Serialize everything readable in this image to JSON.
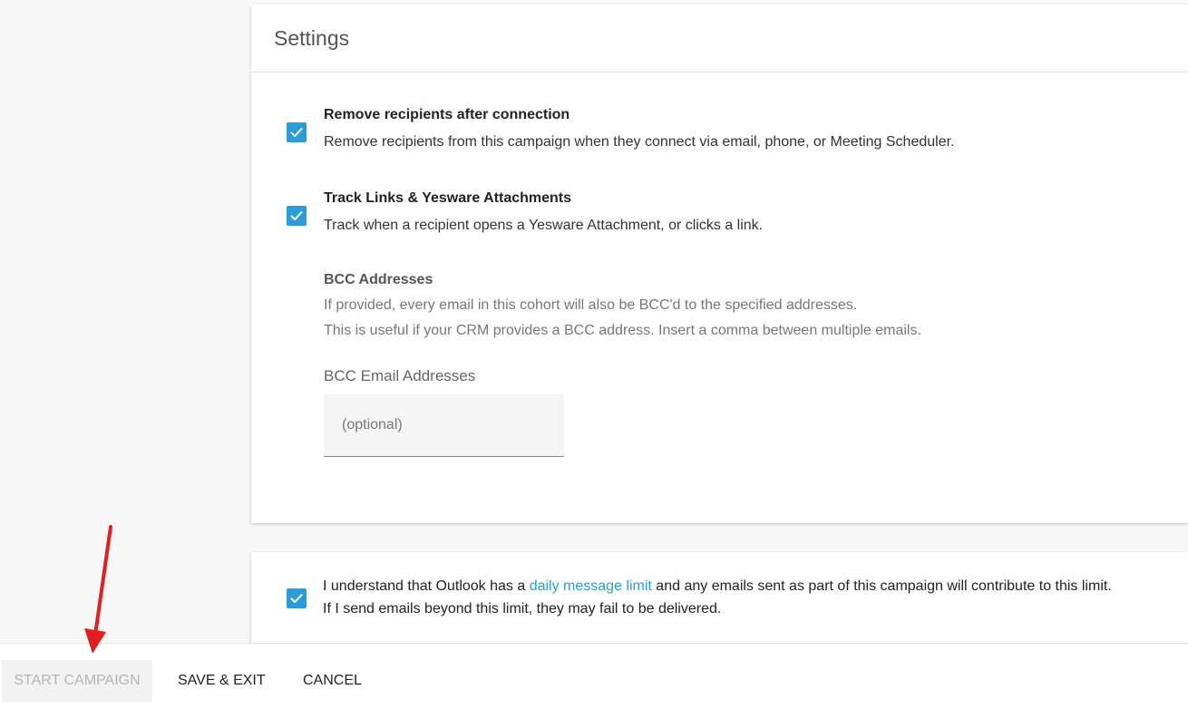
{
  "settings": {
    "title": "Settings",
    "items": [
      {
        "title": "Remove recipients after connection",
        "description": "Remove recipients from this campaign when they connect via email, phone, or Meeting Scheduler.",
        "checked": true
      },
      {
        "title": "Track Links & Yesware Attachments",
        "description": "Track when a recipient opens a Yesware Attachment, or clicks a link.",
        "checked": true
      }
    ],
    "bcc": {
      "title": "BCC Addresses",
      "line1": "If provided, every email in this cohort will also be BCC'd to the specified addresses.",
      "line2": "This is useful if your CRM provides a BCC address. Insert a comma between multiple emails.",
      "field_label": "BCC Email Addresses",
      "placeholder": "(optional)",
      "value": ""
    }
  },
  "consent": {
    "checked": true,
    "text_before": "I understand that Outlook has a ",
    "link_text": "daily message limit",
    "text_after": " and any emails sent as part of this campaign will contribute to this limit.",
    "line2": "If I send emails beyond this limit, they may fail to be delivered."
  },
  "footer": {
    "start_label": "START CAMPAIGN",
    "save_label": "SAVE & EXIT",
    "cancel_label": "CANCEL"
  },
  "colors": {
    "accent": "#2b9cd8",
    "annotation_arrow": "#e02020",
    "disabled_text": "#b5b5b5"
  },
  "icons": {
    "checkbox": "check-icon",
    "annotation": "red-arrow-annotation"
  }
}
